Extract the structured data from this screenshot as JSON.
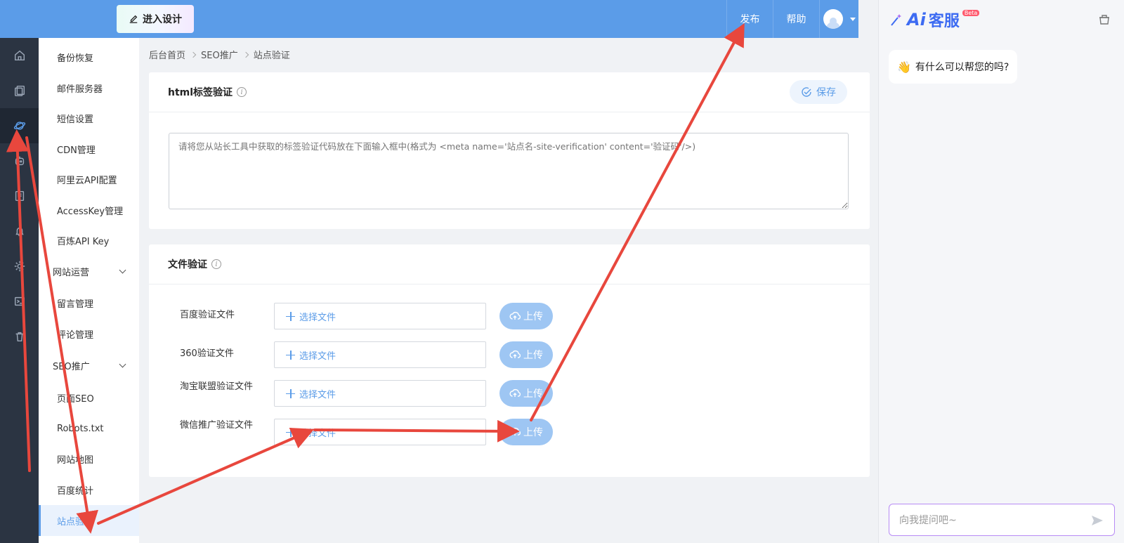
{
  "header": {
    "design_button": "进入设计",
    "publish": "发布",
    "help": "帮助"
  },
  "rail": {
    "icons": [
      "home-icon",
      "copy-icon",
      "planet-icon",
      "robot-icon",
      "book-icon",
      "bell-icon",
      "gear-icon",
      "terminal-icon",
      "trash-icon"
    ],
    "active_index": 2
  },
  "submenu": {
    "items": [
      {
        "label": "备份恢复",
        "type": "item"
      },
      {
        "label": "邮件服务器",
        "type": "item"
      },
      {
        "label": "短信设置",
        "type": "item"
      },
      {
        "label": "CDN管理",
        "type": "item"
      },
      {
        "label": "阿里云API配置",
        "type": "item"
      },
      {
        "label": "AccessKey管理",
        "type": "item"
      },
      {
        "label": "百炼API Key",
        "type": "item"
      },
      {
        "label": "网站运营",
        "type": "group"
      },
      {
        "label": "留言管理",
        "type": "item"
      },
      {
        "label": "评论管理",
        "type": "item"
      },
      {
        "label": "SEO推广",
        "type": "group"
      },
      {
        "label": "页面SEO",
        "type": "item"
      },
      {
        "label": "Robots.txt",
        "type": "item"
      },
      {
        "label": "网站地图",
        "type": "item"
      },
      {
        "label": "百度统计",
        "type": "item"
      },
      {
        "label": "站点验证",
        "type": "item",
        "active": true
      }
    ]
  },
  "breadcrumb": [
    "后台首页",
    "SEO推广",
    "站点验证"
  ],
  "html_panel": {
    "title": "html标签验证",
    "save_label": "保存",
    "placeholder": "请将您从站长工具中获取的标签验证代码放在下面输入框中(格式为 <meta name='站点名-site-verification' content='验证码'/>)"
  },
  "file_panel": {
    "title": "文件验证",
    "select_label": "选择文件",
    "upload_label": "上传",
    "rows": [
      {
        "label": "百度验证文件"
      },
      {
        "label": "360验证文件"
      },
      {
        "label": "淘宝联盟验证文件"
      },
      {
        "label": "微信推广验证文件"
      }
    ]
  },
  "chat": {
    "brand_ai": "Ai",
    "brand_name": "客服",
    "beta": "Beta",
    "greeting": "有什么可以帮您的吗?",
    "input_placeholder": "向我提问吧~"
  },
  "colors": {
    "header": "#5b9ce8",
    "rail": "#2b3442",
    "accent": "#5b9ce8",
    "annotation": "#e8473d"
  }
}
